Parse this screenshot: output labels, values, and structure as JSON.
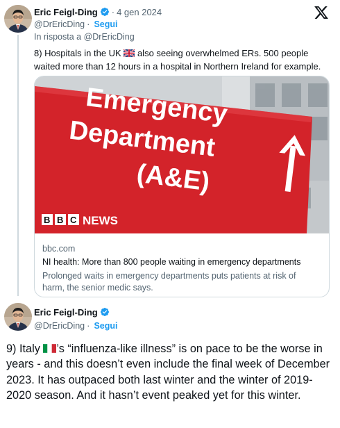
{
  "tweet1": {
    "author_name": "Eric Feigl-Ding",
    "verified_icon": "verified-badge-icon",
    "date": "4 gen 2024",
    "handle": "@DrEricDing",
    "follow_label": "Segui",
    "reply_to": "In risposta a @DrEricDing",
    "text_before_flag": "8) Hospitals in the UK ",
    "flag_icon": "uk-flag-icon",
    "text_after_flag": " also seeing overwhelmed ERs. 500 people waited more than 12 hours in a hospital in Northern Ireland for example.",
    "card": {
      "image_sign_line1": "Emergency",
      "image_sign_line2": "Department",
      "image_sign_line3": "(A&E)",
      "image_brand_b1": "B",
      "image_brand_b2": "B",
      "image_brand_c": "C",
      "image_brand_news": "NEWS",
      "domain": "bbc.com",
      "title": "NI health: More than 800 people waiting in emergency departments",
      "description": "Prolonged waits in emergency departments puts patients at risk of harm, the senior medic says."
    }
  },
  "tweet2": {
    "author_name": "Eric Feigl-Ding",
    "handle": "@DrEricDing",
    "follow_label": "Segui",
    "text_before_flag": "9) Italy ",
    "flag_icon": "italy-flag-icon",
    "text_after_flag": "’s “influenza-like illness” is on pace to be the worse in years - and this doesn’t even include the final week of December 2023. It has outpaced both last winter and the winter of 2019-2020 season. And it hasn’t event peaked yet for this winter."
  },
  "platform": {
    "logo_icon": "x-logo-icon"
  },
  "colors": {
    "accent": "#1d9bf0",
    "secondary_text": "#536471",
    "border": "#cfd9de",
    "sign_red": "#d3232a"
  }
}
